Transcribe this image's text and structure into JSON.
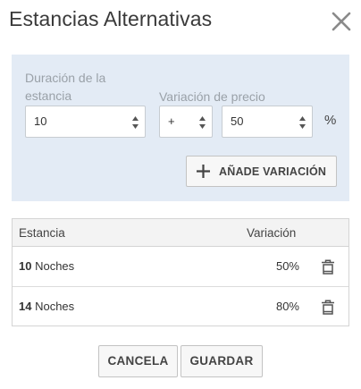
{
  "dialog": {
    "title": "Estancias Alternativas"
  },
  "form": {
    "duration_label": "Duración de la estancia",
    "price_variation_label": "Variación de precio",
    "duration_value": "10",
    "sign_value": "+",
    "variation_value": "50",
    "percent_symbol": "%",
    "add_button_label": "AÑADE VARIACIÓN"
  },
  "table": {
    "headers": {
      "stay": "Estancia",
      "variation": "Variación"
    },
    "rows": [
      {
        "nights": "10",
        "unit": " Noches",
        "variation": "50%"
      },
      {
        "nights": "14",
        "unit": " Noches",
        "variation": "80%"
      }
    ]
  },
  "footer": {
    "cancel_label": "CANCELA",
    "save_label": "GUARDAR"
  },
  "icons": {
    "close": "close-icon",
    "add": "plus-icon",
    "delete": "trash-icon",
    "spinner": "spinner-arrows-icon"
  }
}
